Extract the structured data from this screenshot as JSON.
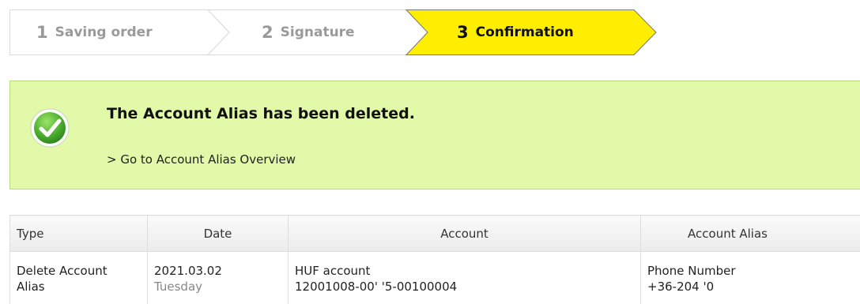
{
  "stepper": {
    "steps": [
      {
        "number": "1",
        "label": "Saving order",
        "state": "done"
      },
      {
        "number": "2",
        "label": "Signature",
        "state": "done"
      },
      {
        "number": "3",
        "label": "Confirmation",
        "state": "active"
      }
    ],
    "active_color": "#ffee00",
    "inactive_color": "#ffffff"
  },
  "banner": {
    "icon": "check-circle-icon",
    "message": "The Account Alias has been deleted.",
    "link": "> Go to Account Alias Overview",
    "background": "#e1f9a8"
  },
  "table": {
    "headers": {
      "type": "Type",
      "date": "Date",
      "account": "Account",
      "alias": "Account Alias"
    },
    "row": {
      "type_line1": "Delete Account",
      "type_line2": "Alias",
      "date": "2021.03.02",
      "weekday": "Tuesday",
      "account_type": "HUF account",
      "account_number": "12001008-00'      '5-00100004",
      "alias_type": "Phone Number",
      "alias_value": "+36-204           '0"
    }
  }
}
